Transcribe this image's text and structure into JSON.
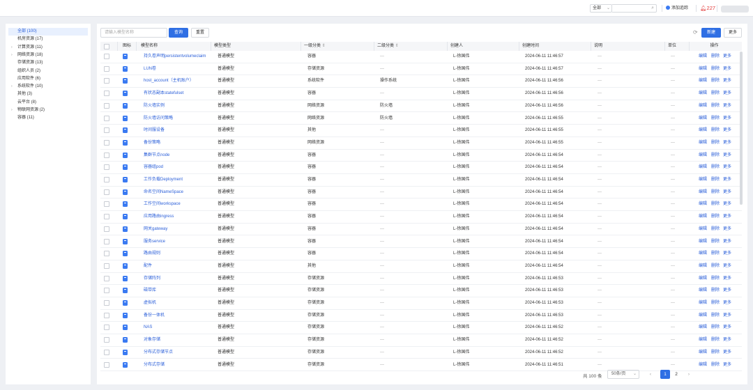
{
  "topbar": {
    "search_scope": "全部",
    "add_tracking": "添加追踪",
    "alarm_count": "227"
  },
  "sidebar": {
    "items": [
      {
        "label": "全部 (100)",
        "active": true,
        "expandable": false
      },
      {
        "label": "机房资源 (17)",
        "active": false,
        "expandable": false
      },
      {
        "label": "计算资源 (11)",
        "active": false,
        "expandable": true
      },
      {
        "label": "网络资源 (18)",
        "active": false,
        "expandable": true
      },
      {
        "label": "存储资源 (13)",
        "active": false,
        "expandable": false
      },
      {
        "label": "组织人员 (2)",
        "active": false,
        "expandable": false
      },
      {
        "label": "应用软件 (6)",
        "active": false,
        "expandable": false
      },
      {
        "label": "系统软件 (10)",
        "active": false,
        "expandable": true
      },
      {
        "label": "其他 (3)",
        "active": false,
        "expandable": false
      },
      {
        "label": "云平台 (8)",
        "active": false,
        "expandable": false
      },
      {
        "label": "物联网资源 (2)",
        "active": false,
        "expandable": true
      },
      {
        "label": "容器 (11)",
        "active": false,
        "expandable": false
      }
    ]
  },
  "toolbar": {
    "search_placeholder": "请输入模型名称",
    "query_label": "查询",
    "reset_label": "重置",
    "new_label": "新建",
    "more_label": "更多"
  },
  "table": {
    "columns": {
      "icon": "图标",
      "name": "模型名称",
      "type": "模型类型",
      "cat1": "一级分类",
      "cat2": "二级分类",
      "creator": "创建人",
      "created": "创建时间",
      "desc": "说明",
      "unit": "单位",
      "ops": "操作"
    },
    "ops": {
      "edit": "编辑",
      "delete": "删除",
      "more": "更多"
    },
    "rows": [
      {
        "name": "持久卷声明persistentvolumeclaim",
        "type": "普通模型",
        "cat1": "容器",
        "cat2": "—",
        "creator": "L-徐国伟",
        "created": "2024-06-11 11:46:57",
        "desc": "—",
        "unit": "—"
      },
      {
        "name": "LUN卷",
        "type": "普通模型",
        "cat1": "存储资源",
        "cat2": "—",
        "creator": "L-徐国伟",
        "created": "2024-06-11 11:46:57",
        "desc": "—",
        "unit": "—"
      },
      {
        "name": "host_account（主机账户）",
        "type": "普通模型",
        "cat1": "系统软件",
        "cat2": "操作系统",
        "creator": "L-徐国伟",
        "created": "2024-06-11 11:46:56",
        "desc": "—",
        "unit": "—"
      },
      {
        "name": "有状态副本statefulset",
        "type": "普通模型",
        "cat1": "容器",
        "cat2": "—",
        "creator": "L-徐国伟",
        "created": "2024-06-11 11:46:56",
        "desc": "—",
        "unit": "—"
      },
      {
        "name": "防火墙实例",
        "type": "普通模型",
        "cat1": "网络资源",
        "cat2": "防火墙",
        "creator": "L-徐国伟",
        "created": "2024-06-11 11:46:56",
        "desc": "—",
        "unit": "—"
      },
      {
        "name": "防火墙访问策略",
        "type": "普通模型",
        "cat1": "网络资源",
        "cat2": "防火墙",
        "creator": "L-徐国伟",
        "created": "2024-06-11 11:46:55",
        "desc": "—",
        "unit": "—"
      },
      {
        "name": "时间服设备",
        "type": "普通模型",
        "cat1": "其他",
        "cat2": "—",
        "creator": "L-徐国伟",
        "created": "2024-06-11 11:46:55",
        "desc": "—",
        "unit": "—"
      },
      {
        "name": "备份策略",
        "type": "普通模型",
        "cat1": "网络资源",
        "cat2": "—",
        "creator": "L-徐国伟",
        "created": "2024-06-11 11:46:55",
        "desc": "—",
        "unit": "—"
      },
      {
        "name": "集群节点node",
        "type": "普通模型",
        "cat1": "容器",
        "cat2": "—",
        "creator": "L-徐国伟",
        "created": "2024-06-11 11:46:54",
        "desc": "—",
        "unit": "—"
      },
      {
        "name": "容器组pod",
        "type": "普通模型",
        "cat1": "容器",
        "cat2": "—",
        "creator": "L-徐国伟",
        "created": "2024-06-11 11:46:54",
        "desc": "—",
        "unit": "—"
      },
      {
        "name": "工作负载Deployment",
        "type": "普通模型",
        "cat1": "容器",
        "cat2": "—",
        "creator": "L-徐国伟",
        "created": "2024-06-11 11:46:54",
        "desc": "—",
        "unit": "—"
      },
      {
        "name": "命名空间NameSpace",
        "type": "普通模型",
        "cat1": "容器",
        "cat2": "—",
        "creator": "L-徐国伟",
        "created": "2024-06-11 11:46:54",
        "desc": "—",
        "unit": "—"
      },
      {
        "name": "工作空间workspace",
        "type": "普通模型",
        "cat1": "容器",
        "cat2": "—",
        "creator": "L-徐国伟",
        "created": "2024-06-11 11:46:54",
        "desc": "—",
        "unit": "—"
      },
      {
        "name": "应用路由ingress",
        "type": "普通模型",
        "cat1": "容器",
        "cat2": "—",
        "creator": "L-徐国伟",
        "created": "2024-06-11 11:46:54",
        "desc": "—",
        "unit": "—"
      },
      {
        "name": "网关gateway",
        "type": "普通模型",
        "cat1": "容器",
        "cat2": "—",
        "creator": "L-徐国伟",
        "created": "2024-06-11 11:46:54",
        "desc": "—",
        "unit": "—"
      },
      {
        "name": "服务service",
        "type": "普通模型",
        "cat1": "容器",
        "cat2": "—",
        "creator": "L-徐国伟",
        "created": "2024-06-11 11:46:54",
        "desc": "—",
        "unit": "—"
      },
      {
        "name": "路由规则",
        "type": "普通模型",
        "cat1": "容器",
        "cat2": "—",
        "creator": "L-徐国伟",
        "created": "2024-06-11 11:46:54",
        "desc": "—",
        "unit": "—"
      },
      {
        "name": "配件",
        "type": "普通模型",
        "cat1": "其他",
        "cat2": "—",
        "creator": "L-徐国伟",
        "created": "2024-06-11 11:46:54",
        "desc": "—",
        "unit": "—"
      },
      {
        "name": "存储阵列",
        "type": "普通模型",
        "cat1": "存储资源",
        "cat2": "—",
        "creator": "L-徐国伟",
        "created": "2024-06-11 11:46:53",
        "desc": "—",
        "unit": "—"
      },
      {
        "name": "磁带库",
        "type": "普通模型",
        "cat1": "存储资源",
        "cat2": "—",
        "creator": "L-徐国伟",
        "created": "2024-06-11 11:46:53",
        "desc": "—",
        "unit": "—"
      },
      {
        "name": "虚拟机",
        "type": "普通模型",
        "cat1": "存储资源",
        "cat2": "—",
        "creator": "L-徐国伟",
        "created": "2024-06-11 11:46:53",
        "desc": "—",
        "unit": "—"
      },
      {
        "name": "备份一体机",
        "type": "普通模型",
        "cat1": "存储资源",
        "cat2": "—",
        "creator": "L-徐国伟",
        "created": "2024-06-11 11:46:53",
        "desc": "—",
        "unit": "—"
      },
      {
        "name": "NAS",
        "type": "普通模型",
        "cat1": "存储资源",
        "cat2": "—",
        "creator": "L-徐国伟",
        "created": "2024-06-11 11:46:52",
        "desc": "—",
        "unit": "—"
      },
      {
        "name": "对象存储",
        "type": "普通模型",
        "cat1": "存储资源",
        "cat2": "—",
        "creator": "L-徐国伟",
        "created": "2024-06-11 11:46:52",
        "desc": "—",
        "unit": "—"
      },
      {
        "name": "分布式存储节点",
        "type": "普通模型",
        "cat1": "存储资源",
        "cat2": "—",
        "creator": "L-徐国伟",
        "created": "2024-06-11 11:46:52",
        "desc": "—",
        "unit": "—"
      },
      {
        "name": "分布式存储",
        "type": "普通模型",
        "cat1": "存储资源",
        "cat2": "—",
        "creator": "L-徐国伟",
        "created": "2024-06-11 11:46:51",
        "desc": "—",
        "unit": "—"
      }
    ]
  },
  "pager": {
    "total": "共 100 条",
    "page_size": "50条/页",
    "pages": [
      "1",
      "2"
    ]
  },
  "colors": {
    "primary": "#2f6fe4",
    "link": "#2b5fd9",
    "alarm": "#e23b3b",
    "icon": "#3a7af2"
  },
  "icons": [
    "search-icon",
    "bell-icon",
    "refresh-icon",
    "model-icon",
    "sort-icon",
    "chevron-down-icon",
    "expand-icon"
  ]
}
